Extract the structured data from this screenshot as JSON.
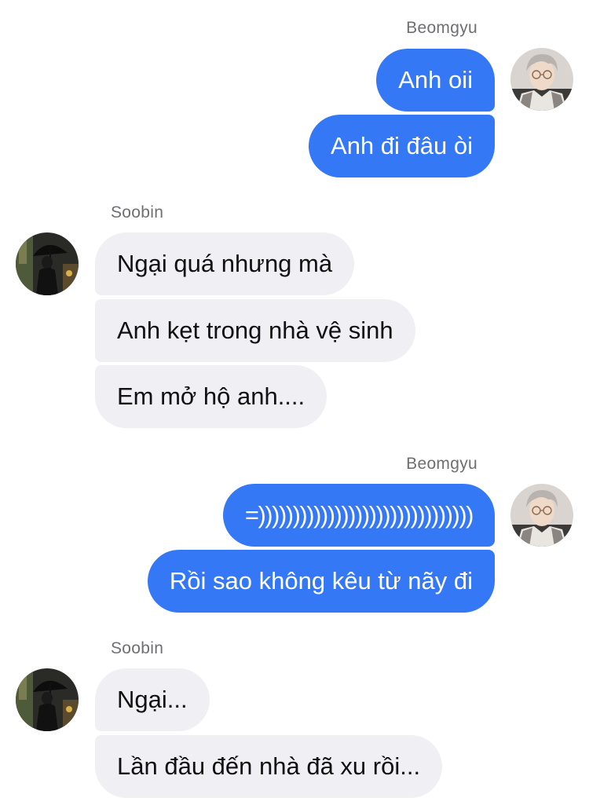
{
  "conversation": {
    "groups": [
      {
        "sender": "Beomgyu",
        "direction": "outgoing",
        "avatar_icon": "beomgyu-avatar",
        "messages": [
          "Anh oii",
          "Anh đi đâu òi"
        ]
      },
      {
        "sender": "Soobin",
        "direction": "incoming",
        "avatar_icon": "soobin-avatar",
        "messages": [
          "Ngại quá nhưng mà",
          "Anh kẹt trong nhà vệ sinh",
          "Em mở hộ anh...."
        ]
      },
      {
        "sender": "Beomgyu",
        "direction": "outgoing",
        "avatar_icon": "beomgyu-avatar",
        "messages": [
          "=)))))))))))))))))))))))))))))))",
          "Rồi sao không kêu từ nãy đi"
        ]
      },
      {
        "sender": "Soobin",
        "direction": "incoming",
        "avatar_icon": "soobin-avatar",
        "messages": [
          "Ngại...",
          "Lần đầu đến nhà đã xu rồi..."
        ]
      }
    ]
  },
  "colors": {
    "outgoing_bubble": "#3478f6",
    "incoming_bubble": "#efeff4",
    "sender_name": "#6e6e73"
  }
}
